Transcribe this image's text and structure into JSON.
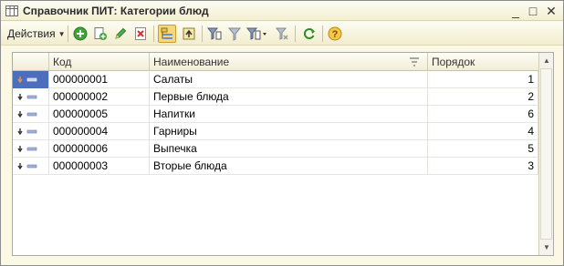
{
  "window": {
    "title": "Справочник ПИТ: Категории блюд",
    "minimize": "_",
    "maximize": "□",
    "close": "✕"
  },
  "toolbar": {
    "actions_label": "Действия",
    "icons": [
      "add-icon",
      "copy-icon",
      "edit-icon",
      "delete-icon",
      "hierarchy-icon",
      "level-up-icon",
      "filter-by-value-icon",
      "filter-icon",
      "filter-dropdown-icon",
      "clear-filter-icon",
      "refresh-icon",
      "help-icon"
    ]
  },
  "table": {
    "columns": [
      "Код",
      "Наименование",
      "Порядок"
    ],
    "rows": [
      {
        "code": "000000001",
        "name": "Салаты",
        "order": "1"
      },
      {
        "code": "000000002",
        "name": "Первые блюда",
        "order": "2"
      },
      {
        "code": "000000005",
        "name": "Напитки",
        "order": "6"
      },
      {
        "code": "000000004",
        "name": "Гарниры",
        "order": "4"
      },
      {
        "code": "000000006",
        "name": "Выпечка",
        "order": "5"
      },
      {
        "code": "000000003",
        "name": "Вторые блюда",
        "order": "3"
      }
    ]
  },
  "colors": {
    "selection": "#4d6ebc",
    "window_bg": "#fbf8e4"
  }
}
